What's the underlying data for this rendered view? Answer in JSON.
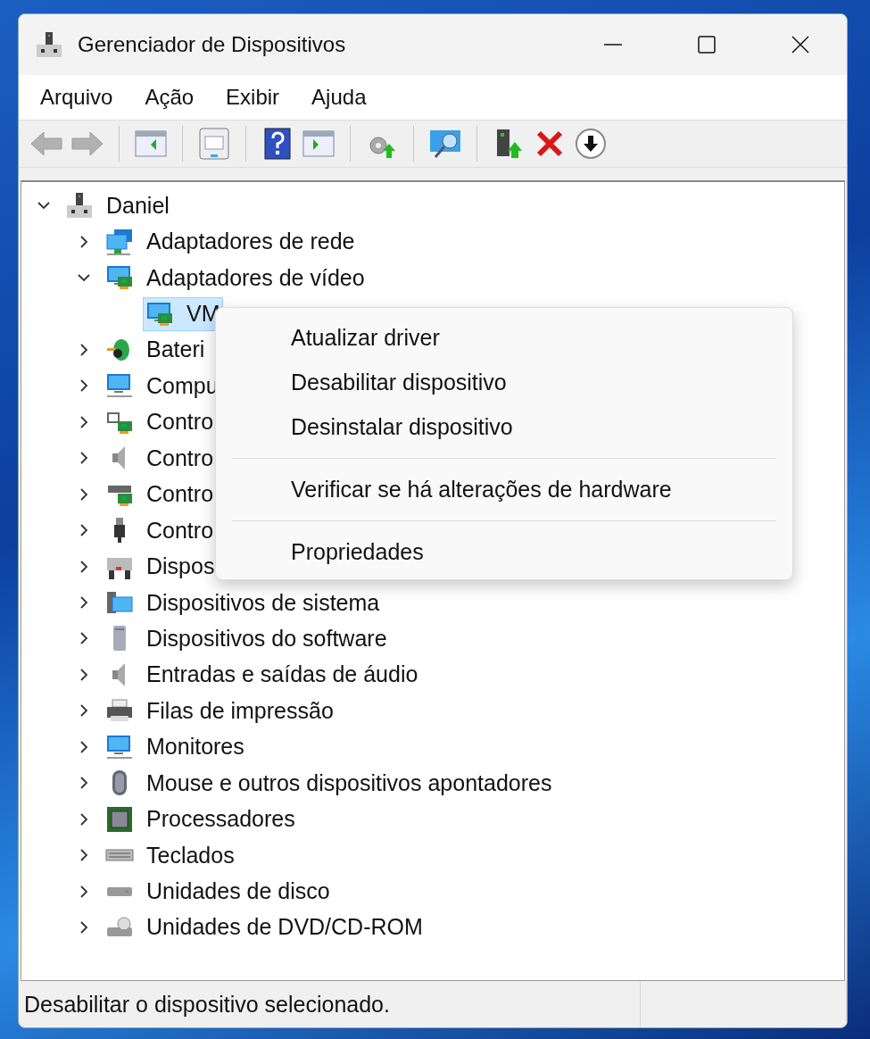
{
  "window": {
    "title": "Gerenciador de Dispositivos"
  },
  "menu_bar": [
    "Arquivo",
    "Ação",
    "Exibir",
    "Ajuda"
  ],
  "toolbar": [
    {
      "disabled": true
    },
    {
      "disabled": true
    },
    {
      "disabled": false
    },
    {
      "disabled": false
    },
    {
      "disabled": false
    },
    {
      "disabled": false
    },
    {
      "disabled": false
    },
    {
      "disabled": false
    },
    {
      "disabled": false
    },
    {
      "disabled": false
    },
    {
      "disabled": false
    }
  ],
  "tree": [
    {
      "label": "Daniel",
      "expanded": true,
      "selected": false,
      "children": [
        {
          "label": "Adaptadores de rede",
          "expanded": false,
          "selected": false
        },
        {
          "label": "Adaptadores de vídeo",
          "expanded": true,
          "selected": false,
          "children": [
            {
              "label": "VM",
              "selected": true
            }
          ]
        },
        {
          "label": "Bateri",
          "expanded": false,
          "selected": false
        },
        {
          "label": "Compu",
          "expanded": false,
          "selected": false
        },
        {
          "label": "Contro",
          "expanded": false,
          "selected": false
        },
        {
          "label": "Contro",
          "expanded": false,
          "selected": false
        },
        {
          "label": "Contro",
          "expanded": false,
          "selected": false
        },
        {
          "label": "Contro",
          "expanded": false,
          "selected": false
        },
        {
          "label": "Dispos",
          "expanded": false,
          "selected": false
        },
        {
          "label": "Dispositivos de sistema",
          "expanded": false,
          "selected": false
        },
        {
          "label": "Dispositivos do software",
          "expanded": false,
          "selected": false
        },
        {
          "label": "Entradas e saídas de áudio",
          "expanded": false,
          "selected": false
        },
        {
          "label": "Filas de impressão",
          "expanded": false,
          "selected": false
        },
        {
          "label": "Monitores",
          "expanded": false,
          "selected": false
        },
        {
          "label": "Mouse e outros dispositivos apontadores",
          "expanded": false,
          "selected": false
        },
        {
          "label": "Processadores",
          "expanded": false,
          "selected": false
        },
        {
          "label": "Teclados",
          "expanded": false,
          "selected": false
        },
        {
          "label": "Unidades de disco",
          "expanded": false,
          "selected": false
        },
        {
          "label": "Unidades de DVD/CD-ROM",
          "expanded": false,
          "selected": false
        }
      ]
    }
  ],
  "context_menu": [
    {
      "kind": "item",
      "label": "Atualizar driver"
    },
    {
      "kind": "item",
      "label": "Desabilitar dispositivo"
    },
    {
      "kind": "item",
      "label": "Desinstalar dispositivo"
    },
    {
      "kind": "separator"
    },
    {
      "kind": "item",
      "label": "Verificar se há alterações de hardware"
    },
    {
      "kind": "separator"
    },
    {
      "kind": "item",
      "label": "Propriedades"
    }
  ],
  "status_bar": {
    "text": "Desabilitar o dispositivo selecionado."
  }
}
